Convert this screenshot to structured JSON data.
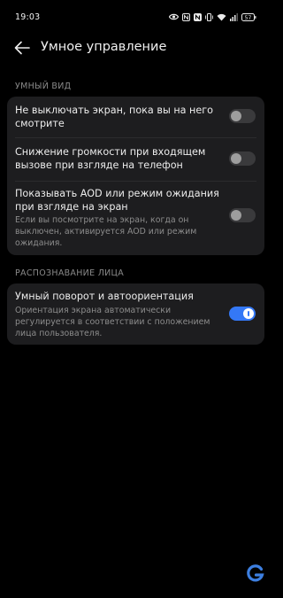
{
  "status_bar": {
    "time": "19:03",
    "battery_level": "57"
  },
  "header": {
    "title": "Умное управление"
  },
  "smart_view": {
    "header": "УМНЫЙ ВИД",
    "items": [
      {
        "title": "Не выключать экран, пока вы на него смотрите",
        "enabled": false
      },
      {
        "title": "Снижение громкости при входящем вызове при взгляде на телефон",
        "enabled": false
      },
      {
        "title": "Показывать AOD или режим ожидания при взгляде на экран",
        "description": "Если вы посмотрите на экран, когда он выключен, активируется AOD или режим ожидания.",
        "enabled": false
      }
    ]
  },
  "face_recognition": {
    "header": "РАСПОЗНАВАНИЕ ЛИЦА",
    "items": [
      {
        "title": "Умный поворот и автоориентация",
        "description": "Ориентация экрана автоматически регулируется в соответствии с положением лица пользователя.",
        "enabled": true
      }
    ]
  },
  "colors": {
    "accent": "#3478f6",
    "background": "#000000",
    "card": "#1d1d1f"
  }
}
